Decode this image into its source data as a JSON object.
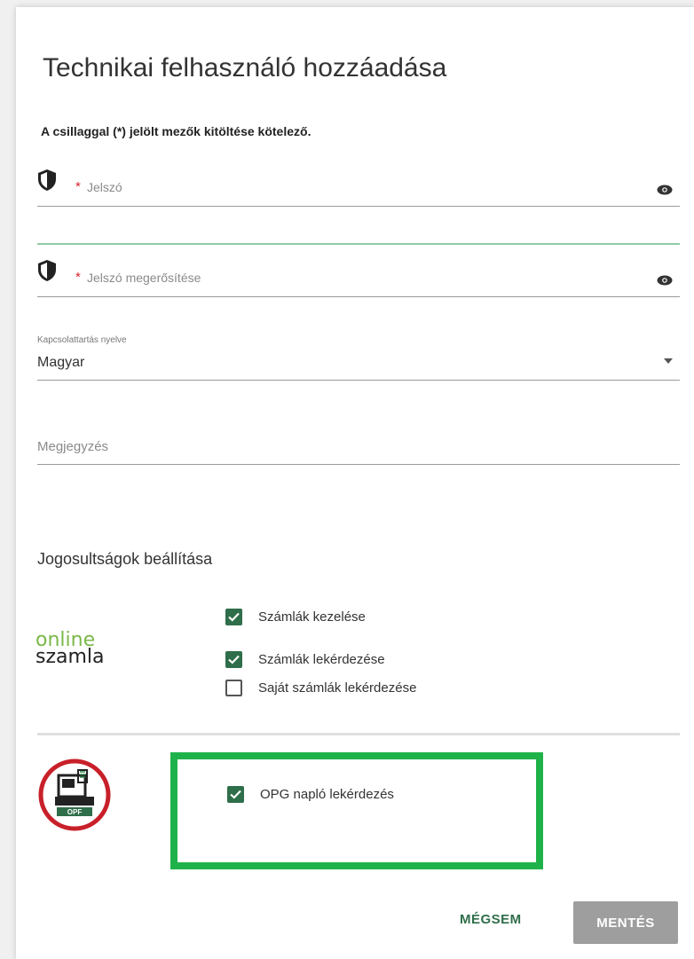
{
  "dialog": {
    "title": "Technikai felhasználó hozzáadása",
    "required_note": "A csillaggal (*) jelölt mezők kitöltése kötelező."
  },
  "password": {
    "required_mark": "*",
    "placeholder": "Jelszó",
    "icon": "shield-icon",
    "toggle_icon": "eye-icon"
  },
  "password_confirm": {
    "required_mark": "*",
    "placeholder": "Jelszó megerősítése",
    "icon": "shield-icon",
    "toggle_icon": "eye-icon"
  },
  "language": {
    "label": "Kapcsolattartás nyelve",
    "value": "Magyar"
  },
  "comment": {
    "placeholder": "Megjegyzés"
  },
  "permissions": {
    "title": "Jogosultságok beállítása",
    "online_szamla_logo": {
      "line1": "online",
      "line2": "szamla"
    },
    "items": [
      {
        "label": "Számlák kezelése",
        "checked": true
      },
      {
        "label": "Számlák lekérdezése",
        "checked": true
      },
      {
        "label": "Saját számlák lekérdezése",
        "checked": false
      }
    ],
    "opg": {
      "logo_text": "OPF",
      "label": "OPG napló lekérdezés",
      "checked": true
    }
  },
  "actions": {
    "cancel": "MÉGSEM",
    "save": "MENTÉS"
  },
  "colors": {
    "accent": "#2f6e4a",
    "highlight": "#20b24a",
    "required": "#d8262f",
    "save_button": "#9e9e9e",
    "opg_ring": "#c8202a"
  }
}
